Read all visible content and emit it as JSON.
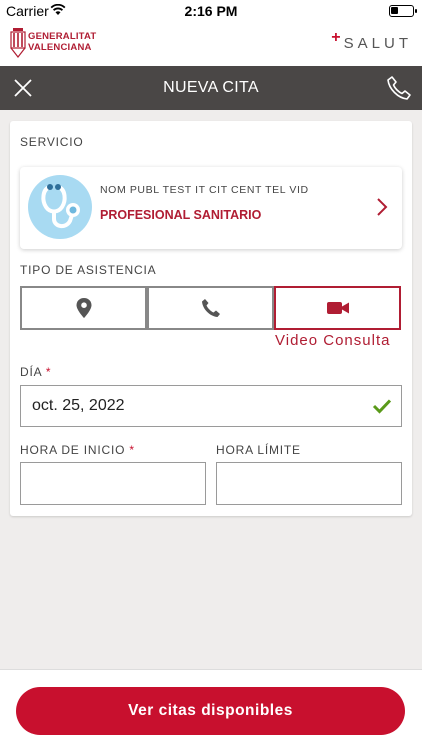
{
  "status": {
    "carrier": "Carrier",
    "time": "2:16 PM"
  },
  "brand": {
    "org_line1": "GENERALITAT",
    "org_line2": "VALENCIANA",
    "app_plus": "+",
    "app_name": "SALUT"
  },
  "nav": {
    "title": "NUEVA CITA",
    "close_icon": "close-icon",
    "phone_icon": "phone-icon"
  },
  "form": {
    "service_label": "SERVICIO",
    "service": {
      "name": "NOM PUBL TEST IT CIT CENT TEL VID",
      "type": "PROFESIONAL SANITARIO",
      "icon": "stethoscope-icon"
    },
    "assist_label": "TIPO DE ASISTENCIA",
    "assist_options": [
      {
        "icon": "location-pin-icon",
        "selected": false
      },
      {
        "icon": "phone-icon",
        "selected": false
      },
      {
        "icon": "video-camera-icon",
        "selected": true
      }
    ],
    "assist_selected_caption": "Video Consulta",
    "day_label": "DÍA",
    "day_value": "oct. 25, 2022",
    "start_label": "HORA DE INICIO",
    "start_value": "",
    "limit_label": "HORA LÍMITE",
    "limit_value": "",
    "required_mark": "*"
  },
  "footer": {
    "cta_label": "Ver citas disponibles"
  },
  "colors": {
    "accent": "#c8102e",
    "brand_red": "#b01d33",
    "navbar": "#4a4746",
    "check_green": "#5a9a1a",
    "background": "#efedec"
  }
}
